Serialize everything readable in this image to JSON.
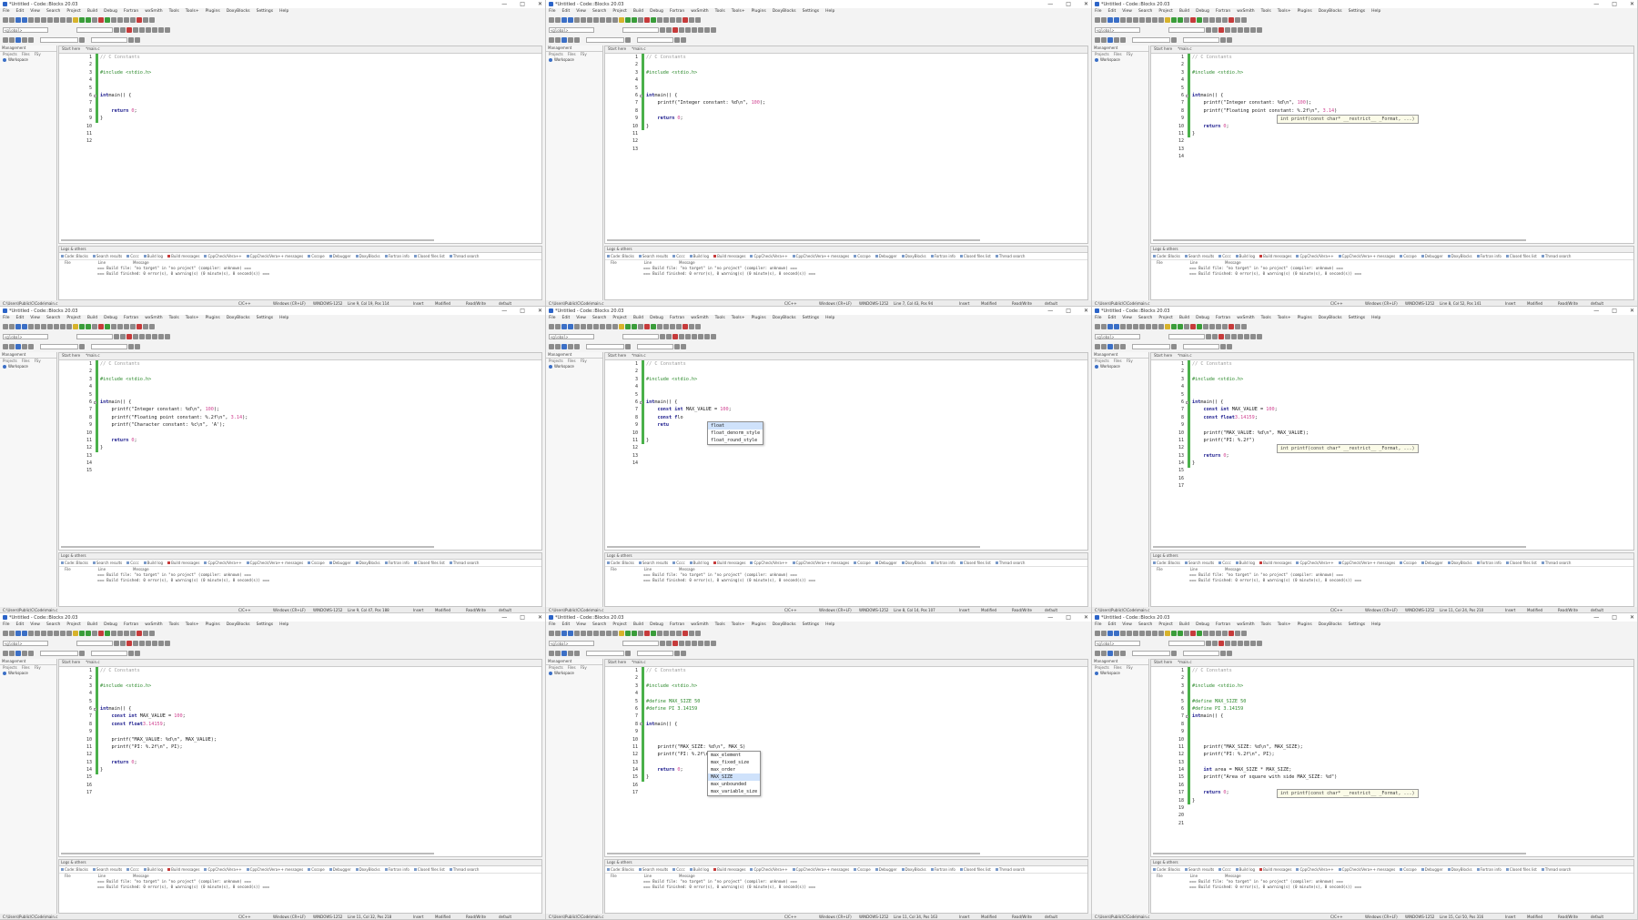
{
  "ide": {
    "title": "*Untitled - Code::Blocks 20.03",
    "window_controls": [
      "—",
      "□",
      "✕"
    ],
    "menu": [
      "File",
      "Edit",
      "View",
      "Search",
      "Project",
      "Build",
      "Debug",
      "Fortran",
      "wxSmith",
      "Tools",
      "Tools+",
      "Plugins",
      "DoxyBlocks",
      "Settings",
      "Help"
    ],
    "global_combo": "<global>",
    "mgmt": {
      "header": "Management",
      "tabs": [
        "Projects",
        "Files",
        "FSy"
      ],
      "workspace": "Workspace"
    },
    "tab_start": "Start here",
    "tab_file": "*main.c",
    "logs_header": "Logs & others",
    "log_tabs": [
      "Code::Blocks",
      "Search results",
      "Cccc",
      "Build log",
      "Build messages",
      "CppCheck/Vera++",
      "CppCheck/Vera++ messages",
      "Cscope",
      "Debugger",
      "DoxyBlocks",
      "Fortran info",
      "Closed files list",
      "Thread search"
    ],
    "log_cols": [
      "File",
      "Line",
      "Message"
    ],
    "log_lines": [
      "=== Build file: \"no target\" in \"no project\" (compiler: unknown) ===",
      "=== Build finished: 0 error(s), 0 warning(s) (0 minute(s), 0 second(s)) ==="
    ],
    "status": {
      "path": "C:\\Users\\Public\\C\\Code\\main.c",
      "lang": "C/C++",
      "eol": "Windows (CR+LF)",
      "enc": "WINDOWS-1252",
      "insert": "Insert",
      "modified": "Modified",
      "rw": "Read/Write",
      "profile": "default"
    }
  },
  "panels": [
    {
      "lines": [
        [
          [
            "c-com",
            "// C Constants"
          ]
        ],
        [],
        [
          [
            "c-pre",
            "#include <stdio.h>"
          ]
        ],
        [],
        [],
        [
          [
            "c-kw",
            "int"
          ],
          [
            "",
            "main() {"
          ]
        ],
        [],
        [
          [
            "",
            "    "
          ],
          [
            "c-kw",
            "return"
          ],
          [
            "c-num",
            " 0"
          ],
          [
            "",
            ";"
          ]
        ],
        [
          [
            "",
            "}"
          ]
        ],
        [],
        [],
        []
      ],
      "numbers": [
        "1",
        "2",
        "3",
        "4",
        "5",
        "6",
        "7",
        "8",
        "9",
        "10",
        "11",
        "12"
      ],
      "cursor": "Line 9, Col 19, Pos 114"
    },
    {
      "lines": [
        [
          [
            "c-com",
            "// C Constants"
          ]
        ],
        [],
        [
          [
            "c-pre",
            "#include <stdio.h>"
          ]
        ],
        [],
        [],
        [
          [
            "c-kw",
            "int"
          ],
          [
            "",
            "main() {"
          ]
        ],
        [
          [
            "",
            "    printf(\"Integer constant: %d\\n\", "
          ],
          [
            "c-num",
            "100"
          ],
          [
            "",
            ");"
          ]
        ],
        [],
        [
          [
            "",
            "    "
          ],
          [
            "c-kw",
            "return"
          ],
          [
            "c-num",
            " 0"
          ],
          [
            "",
            ";"
          ]
        ],
        [
          [
            "",
            "}"
          ]
        ],
        [],
        [],
        []
      ],
      "numbers": [
        "1",
        "2",
        "3",
        "4",
        "5",
        "6",
        "7",
        "8",
        "9",
        "10",
        "11",
        "12",
        "13"
      ],
      "cursor": "Line 7, Col 43, Pos 94"
    },
    {
      "lines": [
        [
          [
            "c-com",
            "// C Constants"
          ]
        ],
        [],
        [
          [
            "c-pre",
            "#include <stdio.h>"
          ]
        ],
        [],
        [],
        [
          [
            "c-kw",
            "int"
          ],
          [
            "",
            "main() {"
          ]
        ],
        [
          [
            "",
            "    printf(\"Integer constant: %d\\n\", "
          ],
          [
            "c-num",
            "100"
          ],
          [
            "",
            ");"
          ]
        ],
        [
          [
            "",
            "    printf(\"Floating point constant: %.2f\\n\", "
          ],
          [
            "c-num",
            "3.14"
          ],
          [
            "",
            ")"
          ]
        ],
        [],
        [
          [
            "",
            "    "
          ],
          [
            "c-kw",
            "return"
          ],
          [
            "c-num",
            " 0"
          ],
          [
            "",
            ";"
          ]
        ],
        [
          [
            "",
            "}"
          ]
        ],
        [],
        [],
        []
      ],
      "numbers": [
        "1",
        "2",
        "3",
        "4",
        "5",
        "6",
        "7",
        "8",
        "9",
        "10",
        "11",
        "12",
        "13",
        "14"
      ],
      "cursor": "Line 8, Col 52, Pos 141",
      "tooltip": {
        "text": "int printf(const char* __restrict__ _Format, ...)",
        "line": 8
      }
    },
    {
      "lines": [
        [
          [
            "c-com",
            "// C Constants"
          ]
        ],
        [],
        [
          [
            "c-pre",
            "#include <stdio.h>"
          ]
        ],
        [],
        [],
        [
          [
            "c-kw",
            "int"
          ],
          [
            "",
            "main() {"
          ]
        ],
        [
          [
            "",
            "    printf(\"Integer constant: %d\\n\", "
          ],
          [
            "c-num",
            "100"
          ],
          [
            "",
            ");"
          ]
        ],
        [
          [
            "",
            "    printf(\"Floating point constant: %.2f\\n\", "
          ],
          [
            "c-num",
            "3.14"
          ],
          [
            "",
            ");"
          ]
        ],
        [
          [
            "",
            "    printf(\"Character constant: %c\\n\", 'A');"
          ]
        ],
        [],
        [
          [
            "",
            "    "
          ],
          [
            "c-kw",
            "return"
          ],
          [
            "c-num",
            " 0"
          ],
          [
            "",
            ";"
          ]
        ],
        [
          [
            "",
            "}"
          ]
        ],
        [],
        [],
        []
      ],
      "numbers": [
        "1",
        "2",
        "3",
        "4",
        "5",
        "6",
        "7",
        "8",
        "9",
        "10",
        "11",
        "12",
        "13",
        "14",
        "15"
      ],
      "cursor": "Line 9, Col 47, Pos 188"
    },
    {
      "lines": [
        [
          [
            "c-com",
            "// C Constants"
          ]
        ],
        [],
        [
          [
            "c-pre",
            "#include <stdio.h>"
          ]
        ],
        [],
        [],
        [
          [
            "c-kw",
            "int"
          ],
          [
            "",
            "main() {"
          ]
        ],
        [
          [
            "",
            "    "
          ],
          [
            "c-kw",
            "const int"
          ],
          [
            "",
            " MAX_VALUE = "
          ],
          [
            "c-num",
            "100"
          ],
          [
            "",
            ";"
          ]
        ],
        [
          [
            "",
            "    "
          ],
          [
            "c-kw",
            "const f"
          ],
          [
            "",
            "lo"
          ]
        ],
        [
          [
            "",
            "    "
          ],
          [
            "c-kw",
            "retu"
          ]
        ],
        [],
        [
          [
            "",
            "}"
          ]
        ],
        [],
        [],
        []
      ],
      "numbers": [
        "1",
        "2",
        "3",
        "4",
        "5",
        "6",
        "7",
        "8",
        "9",
        "10",
        "11",
        "12",
        "13",
        "14"
      ],
      "cursor": "Line 8, Col 14, Pos 107",
      "popup": {
        "items": [
          "float",
          "float_denorm_style",
          "float_round_style"
        ],
        "selected": 0,
        "line": 8
      }
    },
    {
      "lines": [
        [
          [
            "c-com",
            "// C Constants"
          ]
        ],
        [],
        [
          [
            "c-pre",
            "#include <stdio.h>"
          ]
        ],
        [],
        [],
        [
          [
            "c-kw",
            "int"
          ],
          [
            "",
            "main() {"
          ]
        ],
        [
          [
            "",
            "    "
          ],
          [
            "c-kw",
            "const int"
          ],
          [
            "",
            " MAX_VALUE = "
          ],
          [
            "c-num",
            "100"
          ],
          [
            "",
            ";"
          ]
        ],
        [
          [
            "",
            "    "
          ],
          [
            "c-kw",
            "const float"
          ],
          [
            "",
            "",
            " PI = "
          ],
          [
            "c-num",
            "3.14159"
          ],
          [
            "",
            ";"
          ]
        ],
        [],
        [
          [
            "",
            "    printf(\"MAX_VALUE: %d\\n\", MAX_VALUE);"
          ]
        ],
        [
          [
            "",
            "    printf(\"PI: %.2f\")"
          ]
        ],
        [],
        [
          [
            "",
            "    "
          ],
          [
            "c-kw",
            "return"
          ],
          [
            "c-num",
            " 0"
          ],
          [
            "",
            ";"
          ]
        ],
        [
          [
            "",
            "}"
          ]
        ],
        [],
        [],
        []
      ],
      "numbers": [
        "1",
        "2",
        "3",
        "4",
        "5",
        "6",
        "7",
        "8",
        "9",
        "10",
        "11",
        "12",
        "13",
        "14",
        "15",
        "16",
        "17"
      ],
      "cursor": "Line 11, Col 24, Pos 210",
      "tooltip": {
        "text": "int printf(const char* __restrict__ _Format, ...)",
        "line": 11
      }
    },
    {
      "lines": [
        [
          [
            "c-com",
            "// C Constants"
          ]
        ],
        [],
        [
          [
            "c-pre",
            "#include <stdio.h>"
          ]
        ],
        [],
        [],
        [
          [
            "c-kw",
            "int"
          ],
          [
            "",
            "main() {"
          ]
        ],
        [
          [
            "",
            "    "
          ],
          [
            "c-kw",
            "const int"
          ],
          [
            "",
            " MAX_VALUE = "
          ],
          [
            "c-num",
            "100"
          ],
          [
            "",
            ";"
          ]
        ],
        [
          [
            "",
            "    "
          ],
          [
            "c-kw",
            "const float"
          ],
          [
            "",
            "",
            " PI = "
          ],
          [
            "c-num",
            "3.14159"
          ],
          [
            "",
            ";"
          ]
        ],
        [],
        [
          [
            "",
            "    printf(\"MAX_VALUE: %d\\n\", MAX_VALUE);"
          ]
        ],
        [
          [
            "",
            "    printf(\"PI: %.2f\\n\", PI);"
          ]
        ],
        [],
        [
          [
            "",
            "    "
          ],
          [
            "c-kw",
            "return"
          ],
          [
            "c-num",
            " 0"
          ],
          [
            "",
            ";"
          ]
        ],
        [
          [
            "",
            "}"
          ]
        ],
        [],
        [],
        []
      ],
      "numbers": [
        "1",
        "2",
        "3",
        "4",
        "5",
        "6",
        "7",
        "8",
        "9",
        "10",
        "11",
        "12",
        "13",
        "14",
        "15",
        "16",
        "17"
      ],
      "cursor": "Line 11, Col 32, Pos 218"
    },
    {
      "lines": [
        [
          [
            "c-com",
            "// C Constants"
          ]
        ],
        [],
        [
          [
            "c-pre",
            "#include <stdio.h>"
          ]
        ],
        [],
        [
          [
            "c-pre",
            "#define MAX_SIZE 50"
          ]
        ],
        [
          [
            "c-pre",
            "#define PI 3.14159"
          ]
        ],
        [],
        [
          [
            "c-kw",
            "int"
          ],
          [
            "",
            "main() {"
          ]
        ],
        [],
        [],
        [
          [
            "",
            "    printf(\"MAX_SIZE: %d\\n\", MAX_S)"
          ]
        ],
        [
          [
            "",
            "    printf(\"PI: %.2f\\n\", PI);"
          ]
        ],
        [],
        [
          [
            "",
            "    "
          ],
          [
            "c-kw",
            "return"
          ],
          [
            "c-num",
            " 0"
          ],
          [
            "",
            ";"
          ]
        ],
        [
          [
            "",
            "}"
          ]
        ],
        [],
        [],
        []
      ],
      "numbers": [
        "1",
        "2",
        "3",
        "4",
        "5",
        "6",
        "7",
        "8",
        "9",
        "10",
        "11",
        "12",
        "13",
        "14",
        "15",
        "16",
        "17"
      ],
      "cursor": "Line 11, Col 34, Pos 163",
      "popup": {
        "items": [
          "max_element",
          "max_fixed_size",
          "max_order",
          "MAX_SIZE",
          "max_unbounded",
          "max_variable_size"
        ],
        "selected": 3,
        "line": 11
      }
    },
    {
      "lines": [
        [
          [
            "c-com",
            "// C Constants"
          ]
        ],
        [],
        [
          [
            "c-pre",
            "#include <stdio.h>"
          ]
        ],
        [],
        [
          [
            "c-pre",
            "#define MAX_SIZE 50"
          ]
        ],
        [
          [
            "c-pre",
            "#define PI 3.14159"
          ]
        ],
        [
          [
            "c-kw",
            "int"
          ],
          [
            "",
            "main() {"
          ]
        ],
        [],
        [],
        [],
        [
          [
            "",
            "    printf(\"MAX_SIZE: %d\\n\", MAX_SIZE);"
          ]
        ],
        [
          [
            "",
            "    printf(\"PI: %.2f\\n\", PI);"
          ]
        ],
        [],
        [
          [
            "",
            "    "
          ],
          [
            "c-kw",
            "int"
          ],
          [
            "",
            " area = MAX_SIZE * MAX_SIZE;"
          ]
        ],
        [
          [
            "",
            "    printf(\"Area of square with side MAX_SIZE: %d\")"
          ]
        ],
        [],
        [
          [
            "",
            "    "
          ],
          [
            "c-kw",
            "return"
          ],
          [
            "c-num",
            " 0"
          ],
          [
            "",
            ";"
          ]
        ],
        [
          [
            "",
            "}"
          ]
        ],
        [],
        [],
        []
      ],
      "numbers": [
        "1",
        "2",
        "3",
        "4",
        "5",
        "6",
        "7",
        "8",
        "9",
        "10",
        "11",
        "12",
        "13",
        "14",
        "15",
        "16",
        "17",
        "18",
        "19",
        "20",
        "21"
      ],
      "cursor": "Line 15, Col 50, Pos 316",
      "tooltip": {
        "text": "int printf(const char* __restrict__ _Format, ...)",
        "line": 16
      }
    }
  ]
}
